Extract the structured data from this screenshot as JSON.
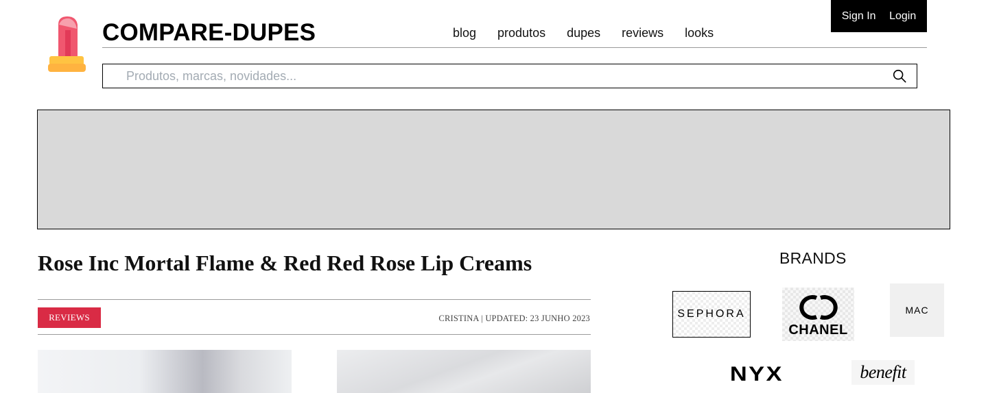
{
  "header": {
    "site_title": "COMPARE-DUPES",
    "logo_icon": "lipstick-icon",
    "auth": {
      "sign_in": "Sign In",
      "login": "Login"
    },
    "nav": [
      {
        "label": "blog"
      },
      {
        "label": "produtos"
      },
      {
        "label": "dupes"
      },
      {
        "label": "reviews"
      },
      {
        "label": "looks"
      }
    ],
    "search": {
      "placeholder": "Produtos, marcas, novidades...",
      "value": "",
      "icon": "search-icon"
    }
  },
  "article": {
    "title": "Rose Inc Mortal Flame & Red Red Rose Lip Creams",
    "category": "REVIEWS",
    "byline": "CRISTINA | UPDATED: 23 JUNHO 2023"
  },
  "sidebar": {
    "brands_title": "BRANDS",
    "brands": [
      {
        "name": "SEPHORA"
      },
      {
        "name": "CHANEL"
      },
      {
        "name": "MAC"
      },
      {
        "name": "NYX"
      },
      {
        "name": "benefit"
      }
    ]
  },
  "colors": {
    "accent": "#d92b45",
    "auth_bar": "#000000",
    "banner": "#d9d9d9",
    "logo_body": "#f0576f",
    "logo_base": "#ffb340"
  }
}
